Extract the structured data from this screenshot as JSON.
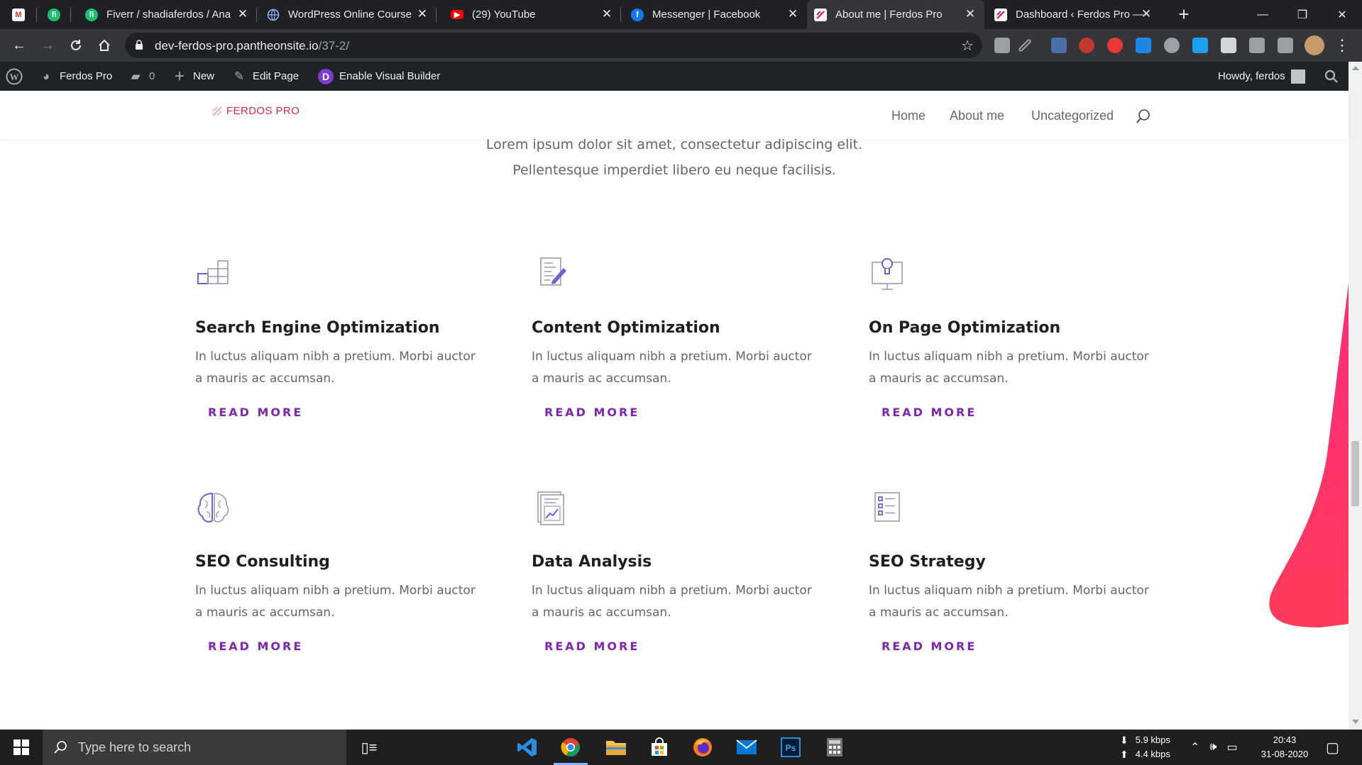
{
  "browser": {
    "tabs": [
      {
        "title": "",
        "favicon": "gmail-icon",
        "color": "#d93025",
        "close": false
      },
      {
        "title": "",
        "favicon": "fiverr-icon",
        "color": "#1dbf73",
        "close": false
      },
      {
        "title": "Fiverr / shadiaferdos / Ana",
        "favicon": "fiverr-icon",
        "color": "#1dbf73",
        "close": true
      },
      {
        "title": "WordPress Online Course",
        "favicon": "globe-icon",
        "color": "#5b8def",
        "close": true
      },
      {
        "title": "(29) YouTube",
        "favicon": "youtube-icon",
        "color": "#ff0000",
        "close": true
      },
      {
        "title": "Messenger | Facebook",
        "favicon": "facebook-icon",
        "color": "#1877f2",
        "close": true
      },
      {
        "title": "About me | Ferdos Pro",
        "favicon": "ferdos-pro-icon",
        "color": "#ffffff",
        "close": true,
        "active": true
      },
      {
        "title": "Dashboard ‹ Ferdos Pro —",
        "favicon": "ferdos-pro-icon",
        "color": "#ffffff",
        "close": true
      }
    ],
    "new_tab": "+",
    "url_host": "dev-ferdos-pro.pantheonsite.io",
    "url_path": "/37-2/"
  },
  "admin_bar": {
    "site_name": "Ferdos Pro",
    "comments_count": "0",
    "new_label": "New",
    "edit_label": "Edit Page",
    "builder_label": "Enable Visual Builder",
    "builder_badge": "D",
    "howdy": "Howdy, ferdos"
  },
  "site": {
    "logo": "FERDOS PRO",
    "nav": [
      "Home",
      "About me",
      "Uncategorized"
    ]
  },
  "intro": {
    "line1": "Lorem ipsum dolor sit amet, consectetur adipiscing elit.",
    "line2": "Pellentesque imperdiet libero eu neque facilisis."
  },
  "services": [
    {
      "icon": "stairs-icon",
      "title": "Search Engine Optimization",
      "text": "In luctus aliquam nibh a pretium. Morbi auctor a mauris ac accumsan.",
      "cta": "READ MORE"
    },
    {
      "icon": "document-edit-icon",
      "title": "Content Optimization",
      "text": "In luctus aliquam nibh a pretium. Morbi auctor a mauris ac accumsan.",
      "cta": "READ MORE"
    },
    {
      "icon": "lightbulb-monitor-icon",
      "title": "On Page Optimization",
      "text": "In luctus aliquam nibh a pretium. Morbi auctor a mauris ac accumsan.",
      "cta": "READ MORE"
    },
    {
      "icon": "brain-icon",
      "title": "SEO Consulting",
      "text": "In luctus aliquam nibh a pretium. Morbi auctor a mauris ac accumsan.",
      "cta": "READ MORE"
    },
    {
      "icon": "report-chart-icon",
      "title": "Data Analysis",
      "text": "In luctus aliquam nibh a pretium. Morbi auctor a mauris ac accumsan.",
      "cta": "READ MORE"
    },
    {
      "icon": "checklist-icon",
      "title": "SEO Strategy",
      "text": "In luctus aliquam nibh a pretium. Morbi auctor a mauris ac accumsan.",
      "cta": "READ MORE"
    }
  ],
  "taskbar": {
    "search_placeholder": "Type here to search",
    "down_speed": "5.9 kbps",
    "up_speed": "4.4 kbps",
    "time": "20:43",
    "date": "31-08-2020"
  },
  "colors": {
    "accent_purple": "#8024b3",
    "icon_purple": "#6c63d9",
    "brand_pink": "#e4264f"
  }
}
